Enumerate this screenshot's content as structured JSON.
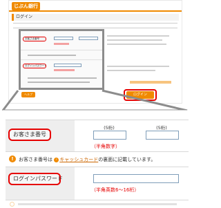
{
  "thumbnail": {
    "brand": "じぶん銀行",
    "title": "ログイン",
    "fields": [
      {
        "label": "お客さま番号"
      },
      {
        "label": "ログインパスワード"
      }
    ],
    "help_button": "ヘルプ",
    "login_button": "ログイン"
  },
  "zoom": {
    "customer_number_label": "お客さま番号",
    "digits_left": "(5桁)",
    "digits_right": "(5桁)",
    "customer_number_hint": "（半角数字）",
    "info_prefix": "お客さま番号は",
    "info_link": "キャッシュカード",
    "info_suffix": "の裏面に記載しています。",
    "password_label": "ログインパスワード",
    "password_hint": "（半角英数6〜16桁）"
  },
  "colors": {
    "accent": "#f08a00",
    "highlight": "#e60000",
    "frame": "#8c8c8c"
  }
}
